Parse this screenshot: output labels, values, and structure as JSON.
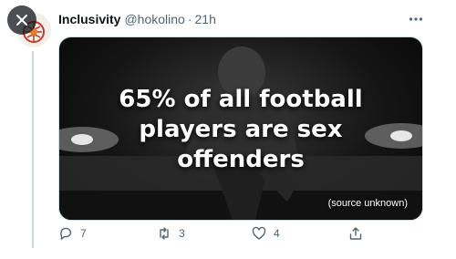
{
  "tweet": {
    "display_name": "Inclusivity",
    "handle": "@hokolino",
    "separator": "·",
    "time": "21h",
    "headline_line1": "65% of all football",
    "headline_line2": "players are sex",
    "headline_line3": "offenders",
    "caption": "(source unknown)"
  },
  "actions": {
    "reply_count": "7",
    "retweet_count": "3",
    "like_count": "4"
  },
  "icons": {
    "close": "close-icon",
    "more": "more-icon",
    "reply": "reply-icon",
    "retweet": "retweet-icon",
    "like": "heart-icon",
    "share": "share-icon"
  },
  "colors": {
    "text": "#0f1419",
    "muted": "#536471",
    "line": "#cfd9de"
  }
}
